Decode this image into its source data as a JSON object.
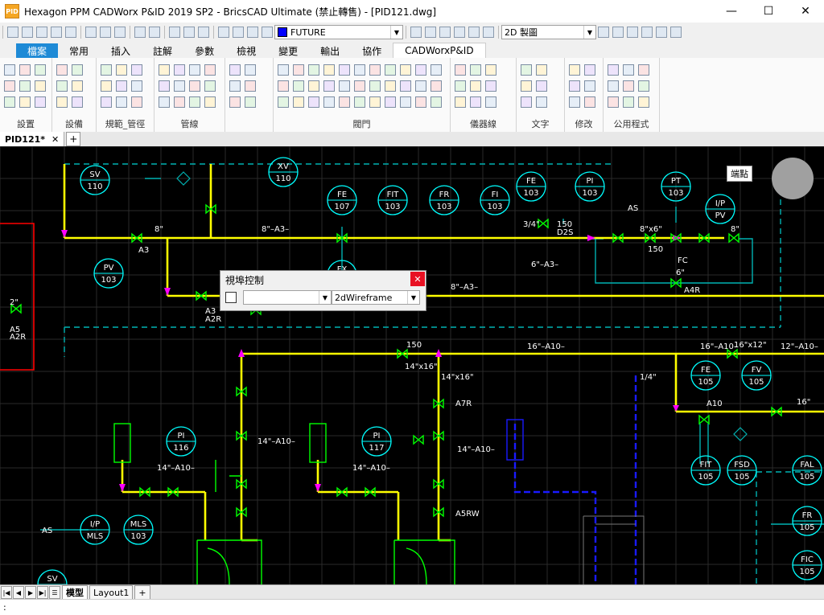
{
  "window": {
    "title": "Hexagon PPM CADWorx P&ID 2019 SP2 - BricsCAD Ultimate (禁止轉售) - [PID121.dwg]",
    "app_icon_text": "PID",
    "minimize": "—",
    "maximize": "☐",
    "close": "✕"
  },
  "qat": {
    "layer_value": "FUTURE",
    "workspace_value": "2D 製圖"
  },
  "tabs": [
    "檔案",
    "常用",
    "插入",
    "註解",
    "參數",
    "檢視",
    "變更",
    "輸出",
    "協作",
    "CADWorxP&ID"
  ],
  "ribbon_groups": [
    "設置",
    "設備",
    "規範_管徑",
    "管線",
    "",
    "閥門",
    "儀器線",
    "文字",
    "修改",
    "公用程式"
  ],
  "doc_tab": {
    "name": "PID121*",
    "close": "✕",
    "add": "+"
  },
  "viewport_control": {
    "title": "視埠控制",
    "close": "✕",
    "visual_style": "2dWireframe"
  },
  "tooltip": "端點",
  "layout_tabs": {
    "model": "模型",
    "layout1": "Layout1",
    "add": "+"
  },
  "command_prompt": ":",
  "drawing": {
    "instruments": [
      {
        "tag": "SV",
        "num": "110"
      },
      {
        "tag": "XV",
        "num": "110"
      },
      {
        "tag": "FE",
        "num": "107"
      },
      {
        "tag": "FIT",
        "num": "103"
      },
      {
        "tag": "FR",
        "num": "103"
      },
      {
        "tag": "FI",
        "num": "103"
      },
      {
        "tag": "FX",
        "num": "103"
      },
      {
        "tag": "FE",
        "num": "103"
      },
      {
        "tag": "PI",
        "num": "103"
      },
      {
        "tag": "PT",
        "num": "103"
      },
      {
        "tag": "I/P",
        "num": "PV"
      },
      {
        "tag": "PV",
        "num": "103"
      },
      {
        "tag": "PI",
        "num": "116"
      },
      {
        "tag": "PI",
        "num": "117"
      },
      {
        "tag": "FE",
        "num": "105"
      },
      {
        "tag": "FV",
        "num": "105"
      },
      {
        "tag": "FIT",
        "num": "105"
      },
      {
        "tag": "FSD",
        "num": "105"
      },
      {
        "tag": "FAL",
        "num": "105"
      },
      {
        "tag": "FR",
        "num": "105"
      },
      {
        "tag": "FIC",
        "num": "105"
      },
      {
        "tag": "I/P",
        "num": "MLS"
      },
      {
        "tag": "MLS",
        "num": "103"
      },
      {
        "tag": "SV",
        "num": ""
      }
    ],
    "labels": [
      "8\"–A3–",
      "6\"–A3–",
      "8\"–A3–",
      "16\"–A10–",
      "16\"–A10–",
      "12\"–A10–",
      "14\"–A10–",
      "14\"–A10–",
      "14\"–A10–",
      "14\"–A10–",
      "8\"",
      "A3",
      "8\"x6\"",
      "150",
      "8\"",
      "3/4\"",
      "150",
      "D2S",
      "2\"",
      "A5",
      "A2R",
      "A3",
      "A2R",
      "A4R",
      "6\"",
      "FC",
      "AS",
      "AS",
      "14\"x16\"",
      "150",
      "14\"x16\"",
      "16\"x12\"",
      "A10",
      "A7R",
      "A5RW",
      "16\"",
      "1/4\""
    ]
  }
}
